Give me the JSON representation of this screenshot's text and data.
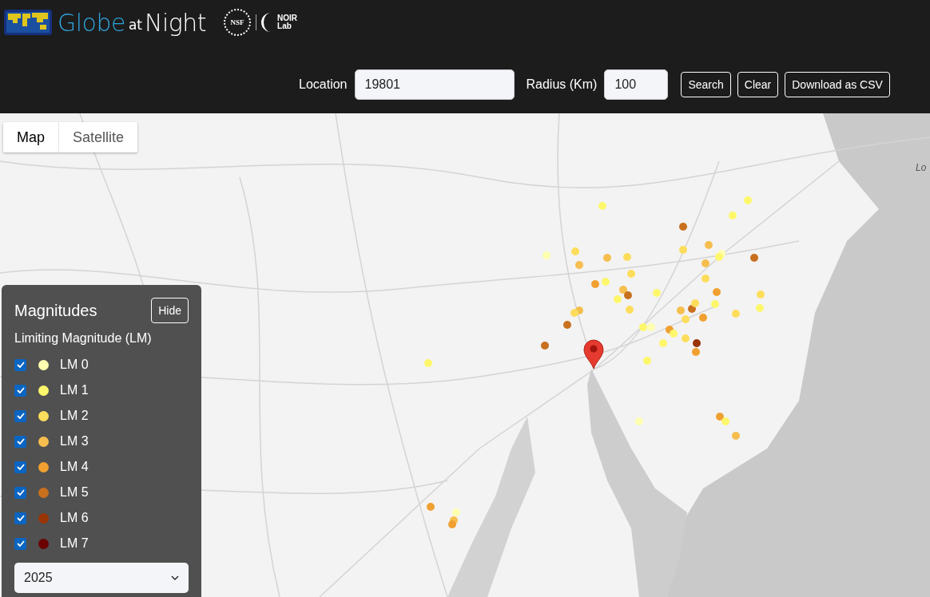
{
  "header": {
    "logo_text_1": "Globe",
    "logo_text_2": "at",
    "logo_text_3": "Night",
    "partner_1": "NSF",
    "partner_2": "NOIR",
    "partner_3": "Lab"
  },
  "search": {
    "location_label": "Location",
    "location_value": "19801",
    "radius_label": "Radius (Km)",
    "radius_value": "100",
    "buttons": [
      "Search",
      "Clear",
      "Download as CSV"
    ]
  },
  "map_type_tabs": [
    {
      "label": "Map",
      "selected": true
    },
    {
      "label": "Satellite",
      "selected": false
    }
  ],
  "map_label": "Lo",
  "legend": {
    "title": "Magnitudes",
    "hide_button": "Hide",
    "subtitle": "Limiting Magnitude (LM)",
    "items": [
      {
        "label": "LM 0",
        "checked": true,
        "color": "#ffffb2"
      },
      {
        "label": "LM 1",
        "checked": true,
        "color": "#fef76c"
      },
      {
        "label": "LM 2",
        "checked": true,
        "color": "#fedd5c"
      },
      {
        "label": "LM 3",
        "checked": true,
        "color": "#f6be4e"
      },
      {
        "label": "LM 4",
        "checked": true,
        "color": "#f0a030"
      },
      {
        "label": "LM 5",
        "checked": true,
        "color": "#c8701e"
      },
      {
        "label": "LM 6",
        "checked": true,
        "color": "#993404"
      },
      {
        "label": "LM 7",
        "checked": true,
        "color": "#6a0000"
      }
    ],
    "year": "2025"
  }
}
